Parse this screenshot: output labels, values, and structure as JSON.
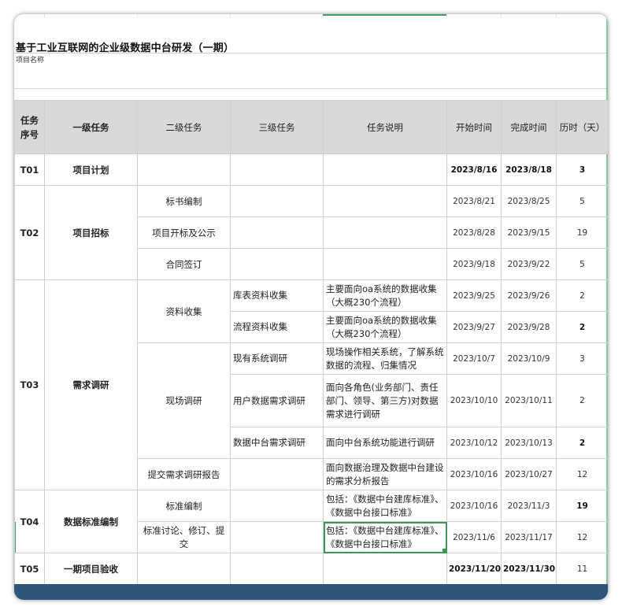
{
  "sheet": {
    "title": "基于工业互联网的企业级数据中台研发（一期）",
    "subtitle": "项目名称"
  },
  "headers": {
    "seq": "任务\n序号",
    "level1": "一级任务",
    "level2": "二级任务",
    "level3": "三级任务",
    "desc": "任务说明",
    "start": "开始时间",
    "end": "完成时间",
    "duration": "历时（天）"
  },
  "rows": {
    "t01": {
      "id": "T01",
      "l1": "项目计划",
      "start": "2023/8/16",
      "end": "2023/8/18",
      "dur": "3"
    },
    "t02": {
      "id": "T02",
      "l1": "项目招标",
      "r1": {
        "l2": "标书编制",
        "start": "2023/8/21",
        "end": "2023/8/25",
        "dur": "5"
      },
      "r2": {
        "l2": "项目开标及公示",
        "start": "2023/8/28",
        "end": "2023/9/15",
        "dur": "19"
      },
      "r3": {
        "l2": "合同签订",
        "start": "2023/9/18",
        "end": "2023/9/22",
        "dur": "5"
      }
    },
    "t03": {
      "id": "T03",
      "l1": "需求调研",
      "g1": {
        "l2": "资料收集"
      },
      "r1": {
        "l3": "库表资料收集",
        "desc": "主要面向oa系统的数据收集（大概230个流程）",
        "start": "2023/9/25",
        "end": "2023/9/26",
        "dur": "2"
      },
      "r2": {
        "l3": "流程资料收集",
        "desc": "主要面向oa系统的数据收集（大概230个流程）",
        "start": "2023/9/27",
        "end": "2023/9/28",
        "dur": "2"
      },
      "g2": {
        "l2": "现场调研"
      },
      "r3": {
        "l3": "现有系统调研",
        "desc": "现场操作相关系统，了解系统数据的流程、归集情况",
        "start": "2023/10/7",
        "end": "2023/10/9",
        "dur": "3"
      },
      "r4": {
        "l3": "用户数据需求调研",
        "desc": "面向各角色(业务部门、责任部门、领导、第三方)对数据需求进行调研",
        "start": "2023/10/10",
        "end": "2023/10/11",
        "dur": "2"
      },
      "r5": {
        "l3": "数据中台需求调研",
        "desc": "面向中台系统功能进行调研",
        "start": "2023/10/12",
        "end": "2023/10/13",
        "dur": "2"
      },
      "r6": {
        "l2": "提交需求调研报告",
        "desc": "面向数据治理及数据中台建设的需求分析报告",
        "start": "2023/10/16",
        "end": "2023/10/27",
        "dur": "12"
      }
    },
    "t04": {
      "id": "T04",
      "l1": "数据标准编制",
      "r1": {
        "l2": "标准编制",
        "desc": "包括：《数据中台建库标准》、《数据中台接口标准》",
        "start": "2023/10/16",
        "end": "2023/11/3",
        "dur": "19"
      },
      "r2": {
        "l2": "标准讨论、修订、提交",
        "desc": "包括：《数据中台建库标准》、《数据中台接口标准》",
        "start": "2023/11/6",
        "end": "2023/11/17",
        "dur": "12"
      }
    },
    "t05": {
      "id": "T05",
      "l1": "一期项目验收",
      "start": "2023/11/20",
      "end": "2023/11/30",
      "dur": "11"
    }
  },
  "colors": {
    "header_bg": "#d9d9d9",
    "selection": "#3a9a52",
    "bottom_bar": "#2e557a"
  }
}
